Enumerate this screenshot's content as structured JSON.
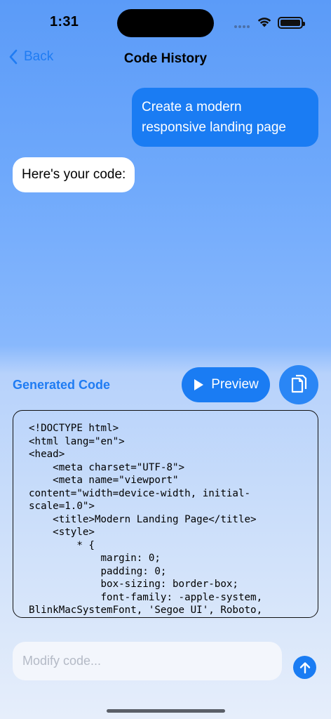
{
  "status_bar": {
    "time": "1:31"
  },
  "nav": {
    "back_label": "Back",
    "title": "Code History"
  },
  "messages": [
    {
      "role": "user",
      "text": "Create a modern responsive landing page"
    },
    {
      "role": "assistant",
      "text": "Here's your code:"
    }
  ],
  "code_panel": {
    "title": "Generated Code",
    "preview_label": "Preview",
    "code": "<!DOCTYPE html>\n<html lang=\"en\">\n<head>\n    <meta charset=\"UTF-8\">\n    <meta name=\"viewport\"\ncontent=\"width=device-width, initial-\nscale=1.0\">\n    <title>Modern Landing Page</title>\n    <style>\n        * {\n            margin: 0;\n            padding: 0;\n            box-sizing: border-box;\n            font-family: -apple-system,\nBlinkMacSystemFont, 'Segoe UI', Roboto,"
  },
  "composer": {
    "placeholder": "Modify code..."
  },
  "icons": {
    "back": "chevron-left-icon",
    "preview": "play-icon",
    "copy": "copy-icon",
    "send": "arrow-up-icon",
    "wifi": "wifi-icon",
    "battery": "battery-icon"
  },
  "colors": {
    "accent": "#1a7cf3",
    "user_bubble": "#1a7cf3",
    "bot_bubble": "#ffffff"
  }
}
